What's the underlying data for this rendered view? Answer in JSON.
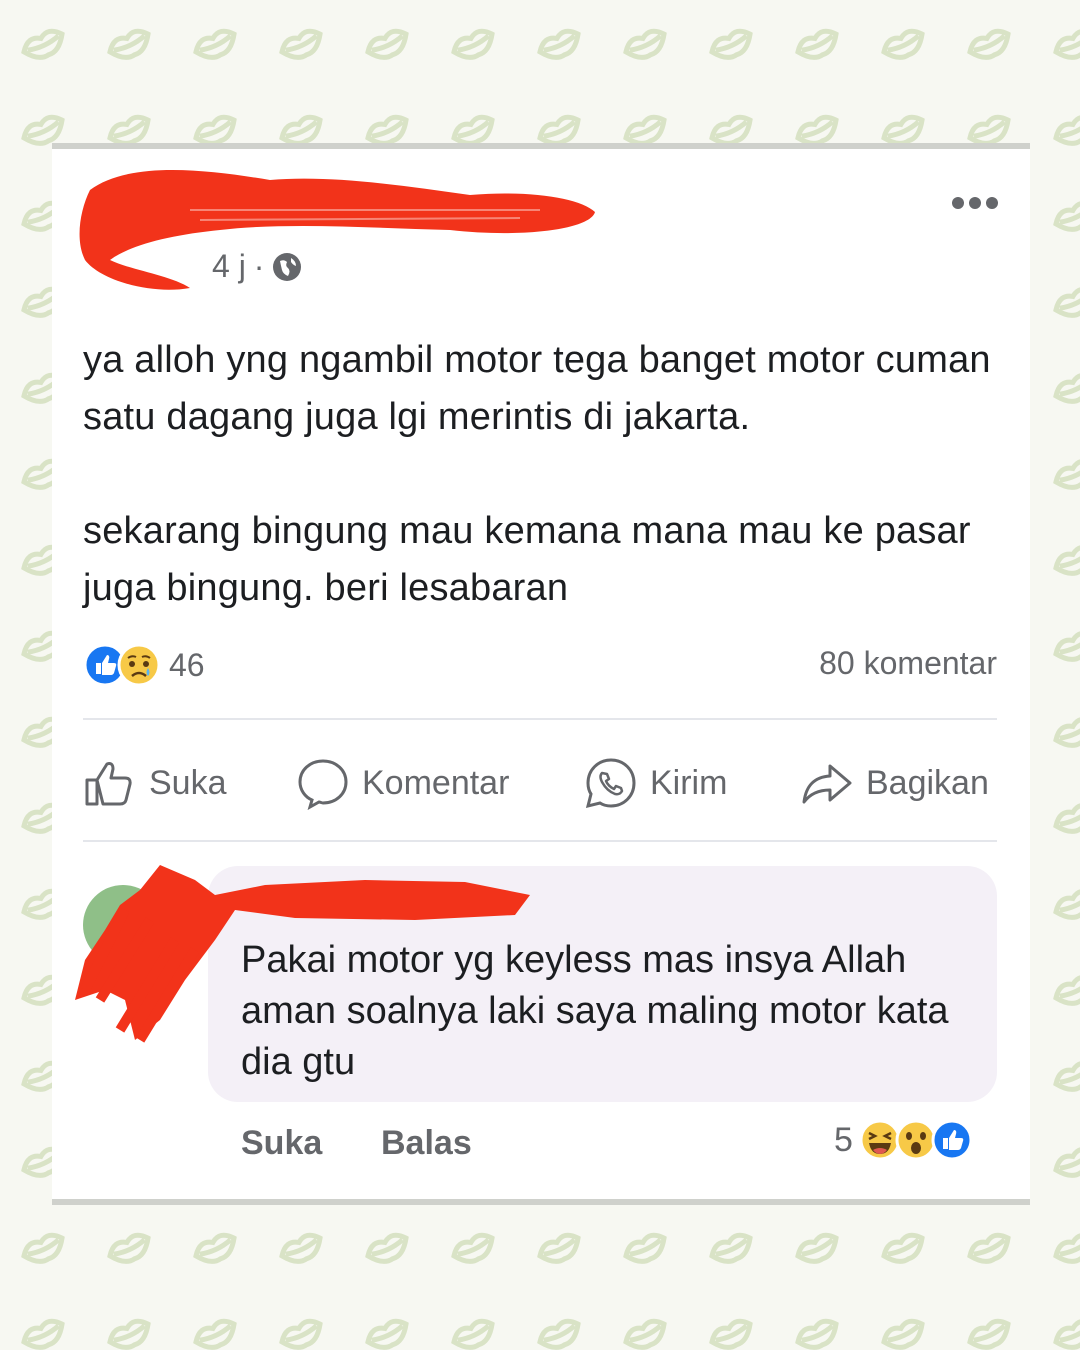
{
  "post": {
    "time": "4 j",
    "separator": "·",
    "text_paragraph_1": "ya alloh yng ngambil motor tega banget motor cuman satu dagang juga lgi merintis di jakarta.",
    "text_paragraph_2": "sekarang bingung mau kemana mana mau ke pasar juga bingung.  beri lesabaran",
    "reaction_count": "46",
    "comments_count": "80 komentar"
  },
  "actions": {
    "like": "Suka",
    "comment": "Komentar",
    "send": "Kirim",
    "share": "Bagikan"
  },
  "comment": {
    "text": "Pakai motor yg keyless mas insya Allah aman soalnya laki saya maling motor kata dia gtu",
    "like_label": "Suka",
    "reply_label": "Balas",
    "reaction_count": "5"
  },
  "colors": {
    "redaction": "#f2331a",
    "facebook_blue": "#1877f2",
    "muted_text": "#65676b",
    "comment_bubble": "#f4f0f7"
  }
}
